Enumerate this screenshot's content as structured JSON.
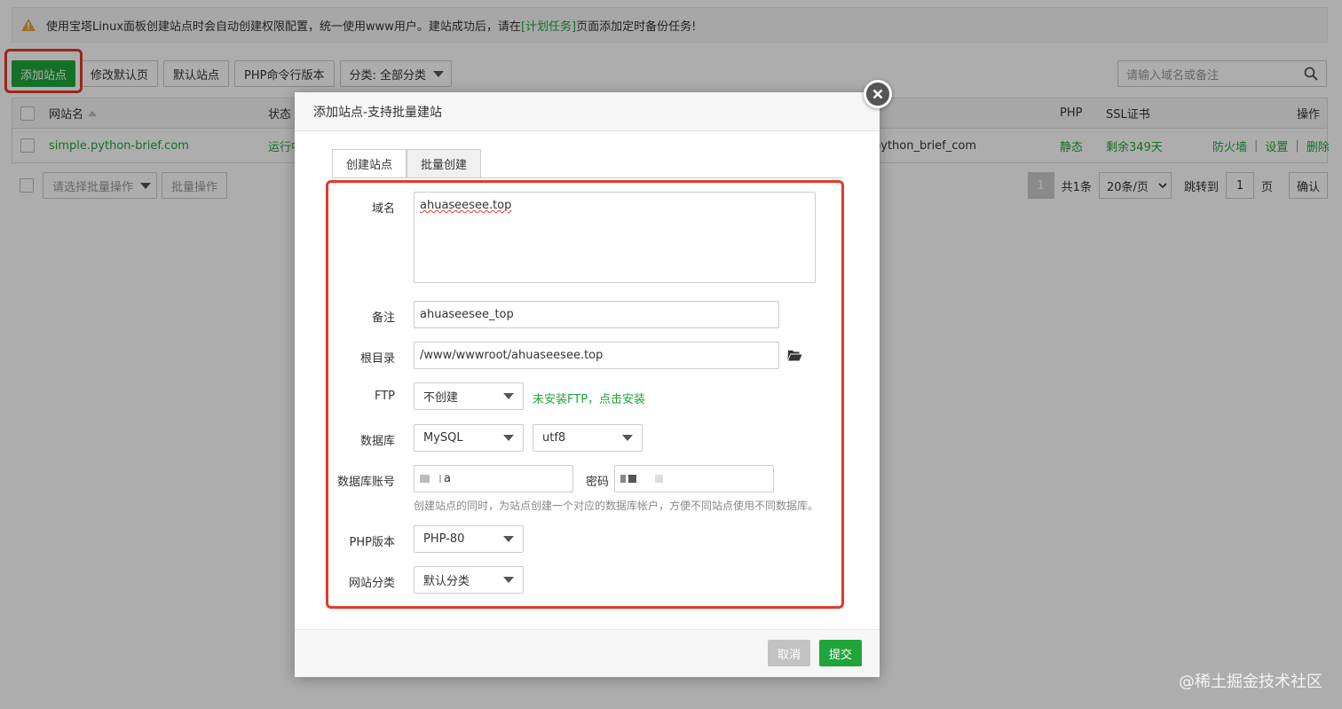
{
  "notice": {
    "text_before": "使用宝塔Linux面板创建站点时会自动创建权限配置，统一使用www用户。建站成功后，请在",
    "link": "[计划任务]",
    "text_after": "页面添加定时备份任务!"
  },
  "toolbar": {
    "add_site": "添加站点",
    "edit_default_page": "修改默认页",
    "default_site": "默认站点",
    "php_cli_version": "PHP命令行版本",
    "category_select": "分类: 全部分类"
  },
  "search": {
    "placeholder": "请输入域名或备注"
  },
  "table": {
    "headers": {
      "name": "网站名",
      "status": "状态",
      "php": "PHP",
      "ssl": "SSL证书",
      "actions": "操作"
    },
    "row": {
      "name": "simple.python-brief.com",
      "status": "运行中",
      "backup_partial": "python_brief_com",
      "php": "静态",
      "ssl": "剩余349天",
      "firewall": "防火墙",
      "settings": "设置",
      "delete": "删除"
    }
  },
  "batch": {
    "select_placeholder": "请选择批量操作",
    "batch_button": "批量操作"
  },
  "pager": {
    "current": "1",
    "total": "共1条",
    "per_page": "20条/页",
    "jump_to": "跳转到",
    "page_input": "1",
    "page_unit": "页",
    "confirm": "确认"
  },
  "dialog": {
    "title": "添加站点-支持批量建站",
    "tabs": [
      "创建站点",
      "批量创建"
    ],
    "form": {
      "domain_label": "域名",
      "domain_value": "ahuaseesee.top",
      "remark_label": "备注",
      "remark_value": "ahuaseesee_top",
      "root_label": "根目录",
      "root_value": "/www/wwwroot/ahuaseesee.top",
      "ftp_label": "FTP",
      "ftp_value": "不创建",
      "ftp_hint": "未安装FTP，点击安装",
      "db_label": "数据库",
      "db_value": "MySQL",
      "db_charset": "utf8",
      "db_account_label": "数据库账号",
      "db_account_visible": "a",
      "password_label": "密码",
      "db_hint": "创建站点的同时，为站点创建一个对应的数据库帐户，方便不同站点使用不同数据库。",
      "php_label": "PHP版本",
      "php_value": "PHP-80",
      "category_label": "网站分类",
      "category_value": "默认分类"
    },
    "cancel": "取消",
    "submit": "提交"
  },
  "watermark": "@稀土掘金技术社区",
  "colors": {
    "accent": "#20a53a",
    "highlight": "#e23a2a",
    "disabled": "#c2c2c2"
  },
  "icons": [
    "warning-icon",
    "search-icon",
    "sort-asc-icon",
    "folder-open-icon",
    "close-icon",
    "chevron-down-icon"
  ]
}
